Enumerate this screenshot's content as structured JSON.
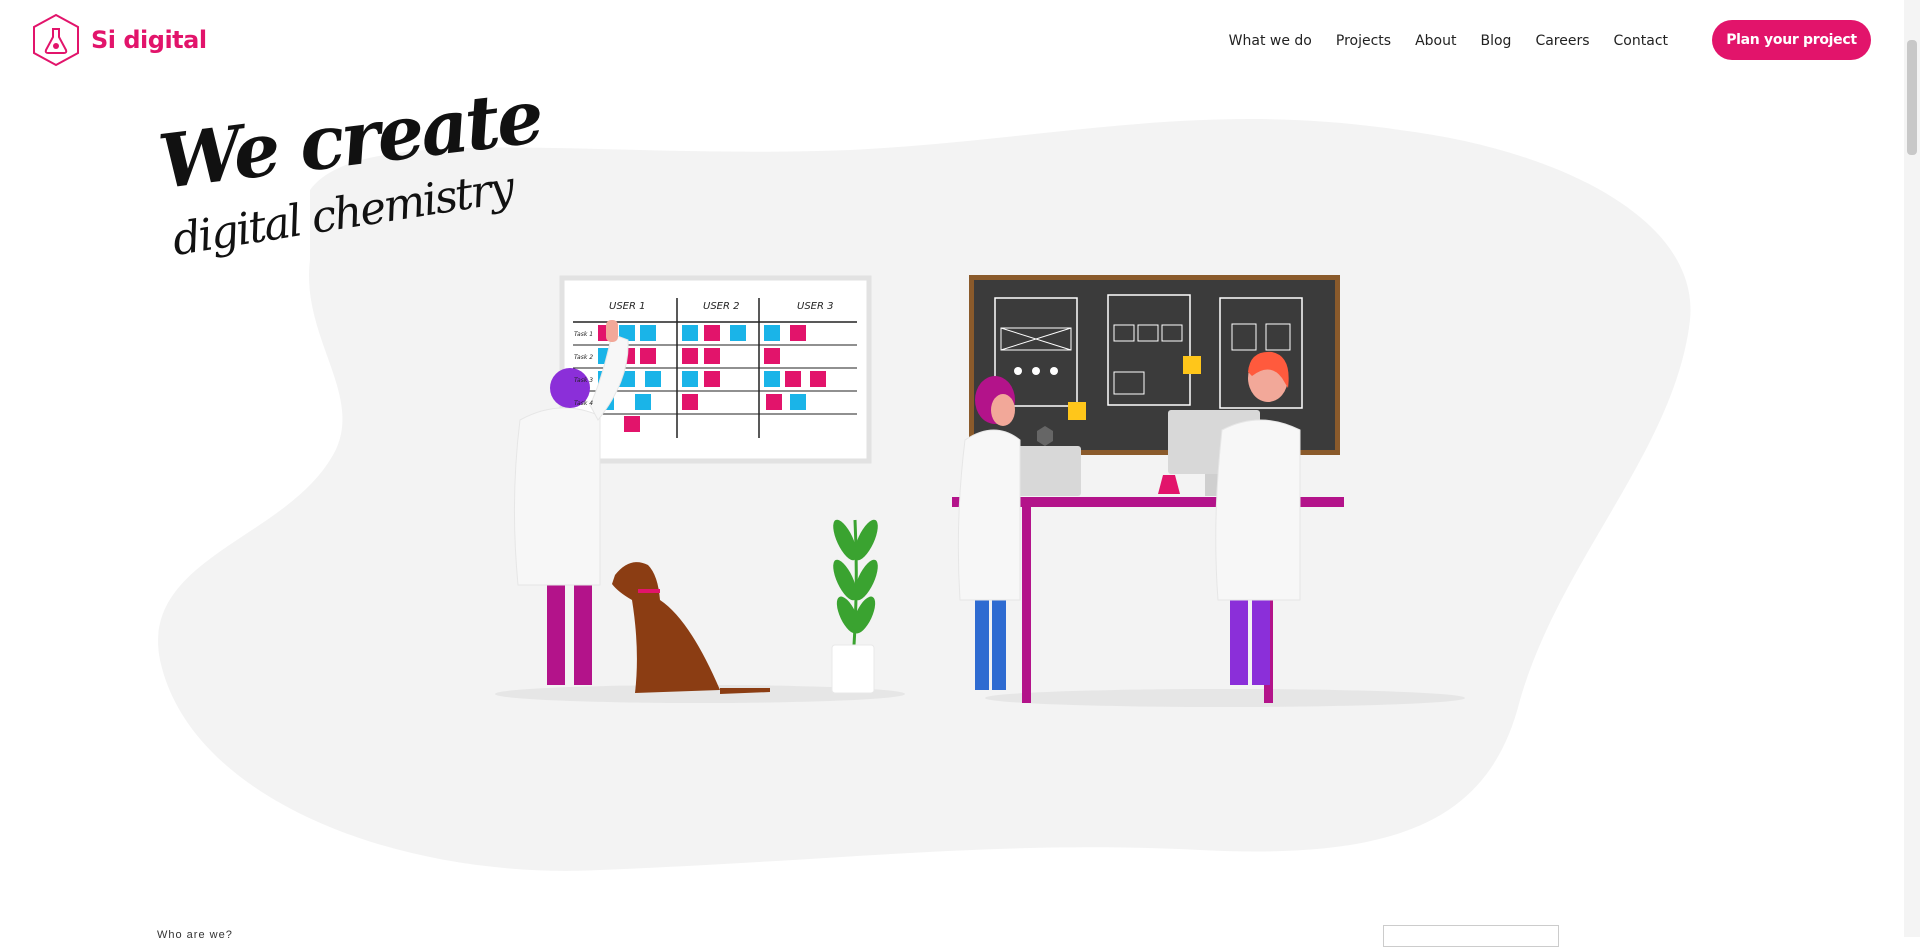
{
  "brand": {
    "name": "Si digital",
    "color": "#e2146b",
    "icon": "flask-hexagon-icon"
  },
  "nav": {
    "items": [
      {
        "label": "What we do"
      },
      {
        "label": "Projects"
      },
      {
        "label": "About"
      },
      {
        "label": "Blog"
      },
      {
        "label": "Careers"
      },
      {
        "label": "Contact"
      }
    ],
    "cta_label": "Plan your project"
  },
  "hero": {
    "headline_line1": "We create",
    "headline_line2": "digital chemistry",
    "board": {
      "columns": [
        "USER 1",
        "USER 2",
        "USER 3"
      ],
      "rows": [
        "Task 1",
        "Task 2",
        "Task 3",
        "Task 4"
      ]
    }
  },
  "below_fold": {
    "label": "Who are we?"
  },
  "colors": {
    "accent": "#e2146b",
    "blob": "#f3f3f3",
    "sticky_pink": "#e2146b",
    "sticky_blue": "#1ab4e8",
    "chalkboard": "#3b3b3b",
    "frame": "#8a5a2b"
  }
}
